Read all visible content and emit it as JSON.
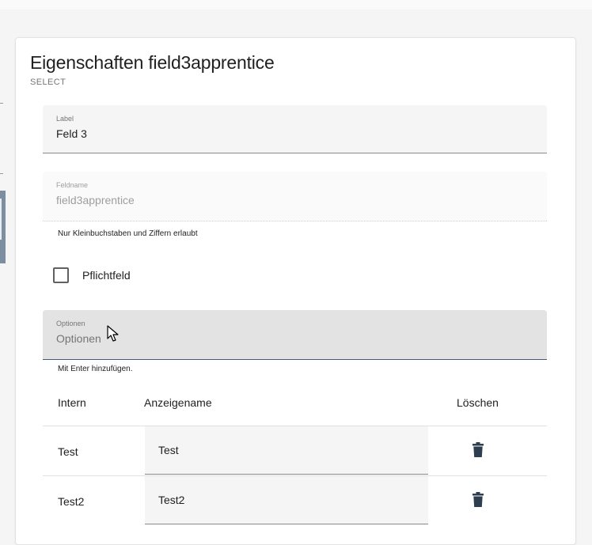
{
  "card": {
    "title": "Eigenschaften field3apprentice",
    "subtitle": "SELECT"
  },
  "fields": {
    "label": {
      "label": "Label",
      "value": "Feld 3"
    },
    "feldname": {
      "label": "Feldname",
      "value": "field3apprentice",
      "hint": "Nur Kleinbuchstaben und Ziffern erlaubt"
    },
    "pflichtfeld": {
      "label": "Pflichtfeld",
      "checked": false
    },
    "optionen": {
      "label": "Optionen",
      "placeholder": "Optionen",
      "hint": "Mit Enter hinzufügen."
    }
  },
  "table": {
    "headers": {
      "intern": "Intern",
      "anzeigename": "Anzeigename",
      "loeschen": "Löschen"
    },
    "rows": [
      {
        "intern": "Test",
        "anzeigename": "Test"
      },
      {
        "intern": "Test2",
        "anzeigename": "Test2"
      }
    ]
  },
  "colors": {
    "accent": "#3f5a7a",
    "sidebar_active": "#7d8ea0",
    "trash": "#2c3e50"
  },
  "icons": {
    "delete": "trash-icon",
    "cursor": "mouse-pointer-icon"
  }
}
